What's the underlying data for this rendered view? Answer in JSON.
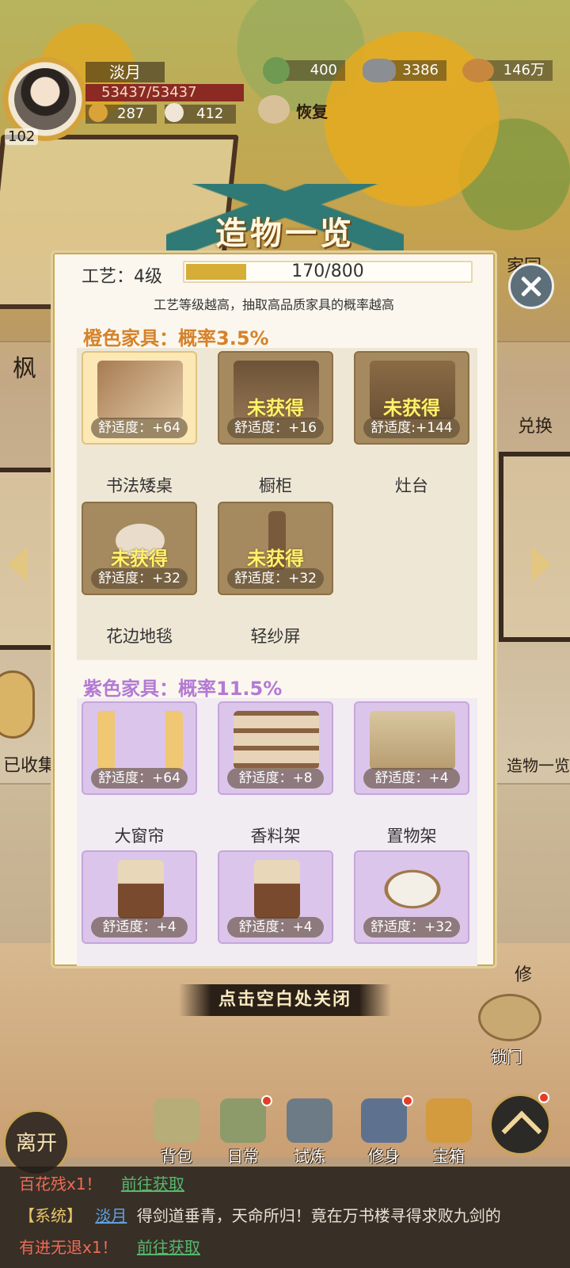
{
  "player": {
    "name": "淡月",
    "hp": "53437/53437",
    "level": "102",
    "stat_a": "287",
    "stat_b": "412"
  },
  "resources": {
    "jade": "400",
    "silver": "3386",
    "coins": "146万",
    "restore_label": "恢复"
  },
  "scene": {
    "left_label_top": "枫",
    "left_label_collected": "已收集",
    "right_label_exchange": "兑换",
    "right_label_overview": "造物一览",
    "right_label_home": "家园",
    "right_label_repair": "修"
  },
  "modal": {
    "title": "造物一览",
    "craft_label": "工艺：4级",
    "craft_progress_text": "170/800",
    "craft_progress_fraction": 0.2125,
    "craft_tip": "工艺等级越高，抽取高品质家具的概率越高",
    "orange_section_title": "橙色家具：概率3.5%",
    "purple_section_title": "紫色家具：概率11.5%",
    "locked_text": "未获得",
    "orange_items": [
      {
        "name": "书法矮桌",
        "comfort": "舒适度：+64",
        "obtained": true
      },
      {
        "name": "橱柜",
        "comfort": "舒适度：+16",
        "obtained": false
      },
      {
        "name": "灶台",
        "comfort": "舒适度:+144",
        "obtained": false
      },
      {
        "name": "花边地毯",
        "comfort": "舒适度：+32",
        "obtained": false
      },
      {
        "name": "轻纱屏",
        "comfort": "舒适度：+32",
        "obtained": false
      }
    ],
    "purple_items": [
      {
        "name": "大窗帘",
        "comfort": "舒适度：+64"
      },
      {
        "name": "香料架",
        "comfort": "舒适度：+8"
      },
      {
        "name": "置物架",
        "comfort": "舒适度：+4"
      },
      {
        "name": "",
        "comfort": "舒适度：+4"
      },
      {
        "name": "",
        "comfort": "舒适度：+4"
      },
      {
        "name": "",
        "comfort": "舒适度：+32"
      }
    ],
    "close_hint": "点击空白处关闭"
  },
  "nav": {
    "leave": "离开",
    "bag": "背包",
    "daily": "日常",
    "trial": "试炼",
    "cultivate": "修身",
    "chest": "宝箱",
    "lock": "锁门"
  },
  "chat": {
    "line1_item": "百花残x1！",
    "line1_link": "前往获取",
    "line2_tag": "【系统】",
    "line2_name": "淡月",
    "line2_text": "得剑道垂青，天命所归！竟在万书楼寻得求败九剑的",
    "line3_item": "有进无退x1！",
    "line3_link": "前往获取"
  },
  "colors": {
    "orange_title": "#d5822a",
    "purple_title": "#b37ad5",
    "progress_fill": "#d6ad36",
    "locked_text": "#fff36a"
  }
}
